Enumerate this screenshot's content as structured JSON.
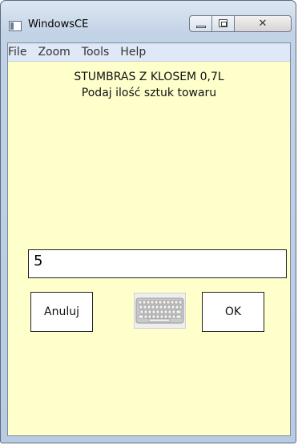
{
  "window": {
    "title": "WindowsCE",
    "buttons": {
      "minimize": "minimize",
      "maximize": "maximize",
      "close": "close"
    },
    "client_background": "#ffffcc"
  },
  "menu": {
    "items": [
      "File",
      "Zoom",
      "Tools",
      "Help"
    ]
  },
  "dialog": {
    "product_name": "STUMBRAS Z KLOSEM 0,7L",
    "prompt": "Podaj ilość sztuk towaru",
    "quantity_value": "5",
    "cancel_label": "Anuluj",
    "ok_label": "OK"
  },
  "icons": {
    "app": "application-icon",
    "keyboard": "keyboard-icon"
  }
}
